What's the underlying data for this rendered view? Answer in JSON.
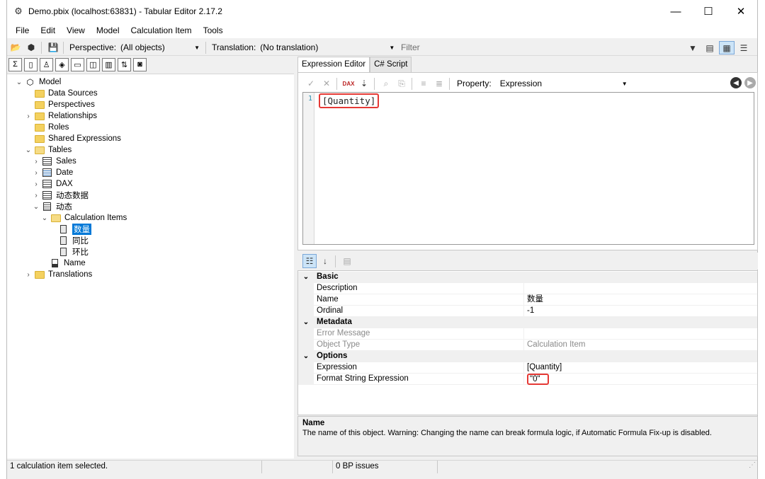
{
  "window": {
    "title": "Demo.pbix (localhost:63831) - Tabular Editor 2.17.2",
    "minimize_glyph": "—",
    "maximize_glyph": "☐",
    "close_glyph": "✕"
  },
  "menu": [
    "File",
    "Edit",
    "View",
    "Model",
    "Calculation Item",
    "Tools"
  ],
  "toolbar": {
    "perspective_label": "Perspective:",
    "perspective_value": "(All objects)",
    "translation_label": "Translation:",
    "translation_value": "(No translation)",
    "filter_placeholder": "Filter"
  },
  "tree": {
    "model": "Model",
    "data_sources": "Data Sources",
    "perspectives": "Perspectives",
    "relationships": "Relationships",
    "roles": "Roles",
    "shared_expressions": "Shared Expressions",
    "tables": "Tables",
    "table_sales": "Sales",
    "table_date": "Date",
    "table_dax": "DAX",
    "table_dynamic_data": "动态数据",
    "table_dynamic": "动态",
    "calculation_items": "Calculation Items",
    "item_quantity": "数量",
    "item_yoy": "同比",
    "item_mom": "环比",
    "column_name": "Name",
    "translations": "Translations"
  },
  "tabs": {
    "expression_editor": "Expression Editor",
    "csharp_script": "C# Script"
  },
  "expression_toolbar": {
    "dax_badge": "DAX",
    "property_label": "Property:",
    "property_value": "Expression"
  },
  "editor": {
    "line_number": "1",
    "code": "[Quantity]"
  },
  "properties": {
    "basic": "Basic",
    "description_label": "Description",
    "description_value": "",
    "name_label": "Name",
    "name_value": "数量",
    "ordinal_label": "Ordinal",
    "ordinal_value": "-1",
    "metadata": "Metadata",
    "error_message_label": "Error Message",
    "error_message_value": "",
    "object_type_label": "Object Type",
    "object_type_value": "Calculation Item",
    "options": "Options",
    "expression_label": "Expression",
    "expression_value": "[Quantity]",
    "format_string_label": "Format String Expression",
    "format_string_value": "\"0\""
  },
  "description": {
    "title": "Name",
    "text": "The name of this object. Warning: Changing the name can break formula logic, if Automatic Formula Fix-up is disabled."
  },
  "status": {
    "left": "1 calculation item selected.",
    "middle": "",
    "bp_issues": "0 BP issues",
    "right": ""
  },
  "colors": {
    "selection": "#0078d7",
    "highlight_box": "#e53935",
    "folder": "#f4d15f"
  }
}
